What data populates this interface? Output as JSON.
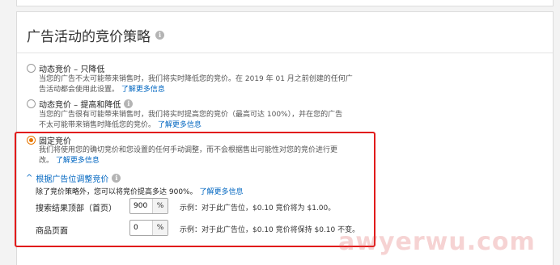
{
  "section": {
    "title": "广告活动的竞价策略",
    "info_icon": "info-icon"
  },
  "options": [
    {
      "label": "动态竞价 – 只降低",
      "selected": false,
      "desc_lines": [
        "当您的广告不太可能带来销售时，我们将实时降低您的竞价。在 2019 年 01 月之前创建的任何广",
        "告活动都会使用此设置。"
      ],
      "learn_more": "了解更多信息"
    },
    {
      "label": "动态竞价 – 提高和降低",
      "selected": false,
      "desc_lines": [
        "当您的广告很有可能带来销售时，我们将实时提高您的竞价（最高可达 100%），并在您的广告",
        "不太可能带来销售时降低您的竞价。"
      ],
      "learn_more": "了解更多信息"
    },
    {
      "label": "固定竞价",
      "selected": true,
      "desc_lines": [
        "我们将使用您的确切竞价和您设置的任何手动调整，而不会根据售出可能性对您的竞价进行更",
        "改。"
      ],
      "learn_more": "了解更多信息"
    }
  ],
  "placement": {
    "toggle_label": "根据广告位调整竞价",
    "intro": "除了竞价策略外，您可以将竞价提高多达 900%。",
    "learn_more": "了解更多信息",
    "rows": [
      {
        "label": "搜索结果顶部（首页）",
        "value": "900",
        "unit": "%",
        "example": "示例：对于此广告位，$0.10 竞价将为 $1.00。"
      },
      {
        "label": "商品页面",
        "value": "0",
        "unit": "%",
        "example": "示例：对于此广告位，$0.10 竞价将保持 $0.10 不变。"
      }
    ]
  },
  "watermark": "awyerwu.com"
}
